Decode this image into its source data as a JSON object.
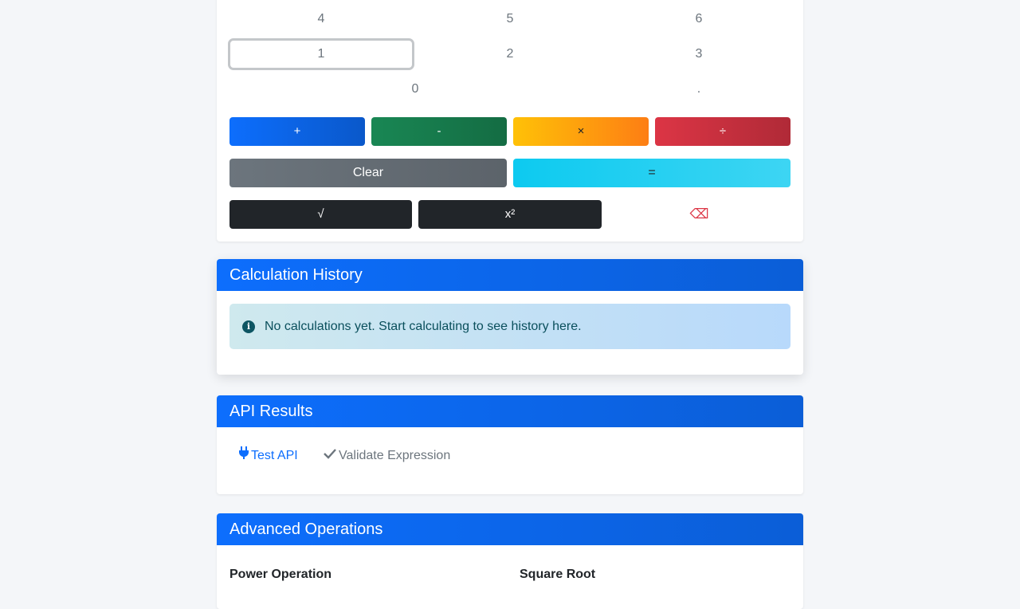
{
  "keypad": {
    "row1": [
      "4",
      "5",
      "6"
    ],
    "row2": [
      "1",
      "2",
      "3"
    ],
    "row3": [
      "0",
      "."
    ]
  },
  "operators": {
    "plus": "+",
    "minus": "-",
    "times": "×",
    "divide": "÷"
  },
  "actions": {
    "clear": "Clear",
    "equals": "=",
    "sqrt": "√",
    "square": "x²",
    "backspace": "⌫"
  },
  "history": {
    "title": "Calculation History",
    "empty_message": "No calculations yet. Start calculating to see history here."
  },
  "api": {
    "title": "API Results",
    "test_label": "Test API",
    "validate_label": "Validate Expression"
  },
  "advanced": {
    "title": "Advanced Operations",
    "power_label": "Power Operation",
    "sqrt_label": "Square Root"
  },
  "colors": {
    "primary": "#0d6efd",
    "success": "#198754",
    "warning": "#ffc107",
    "danger": "#dc3545",
    "secondary": "#6c757d",
    "info": "#0dcaf0",
    "dark": "#212529"
  },
  "icons": {
    "info": "info-circle-icon",
    "plug": "plug-icon",
    "check": "check-icon"
  }
}
